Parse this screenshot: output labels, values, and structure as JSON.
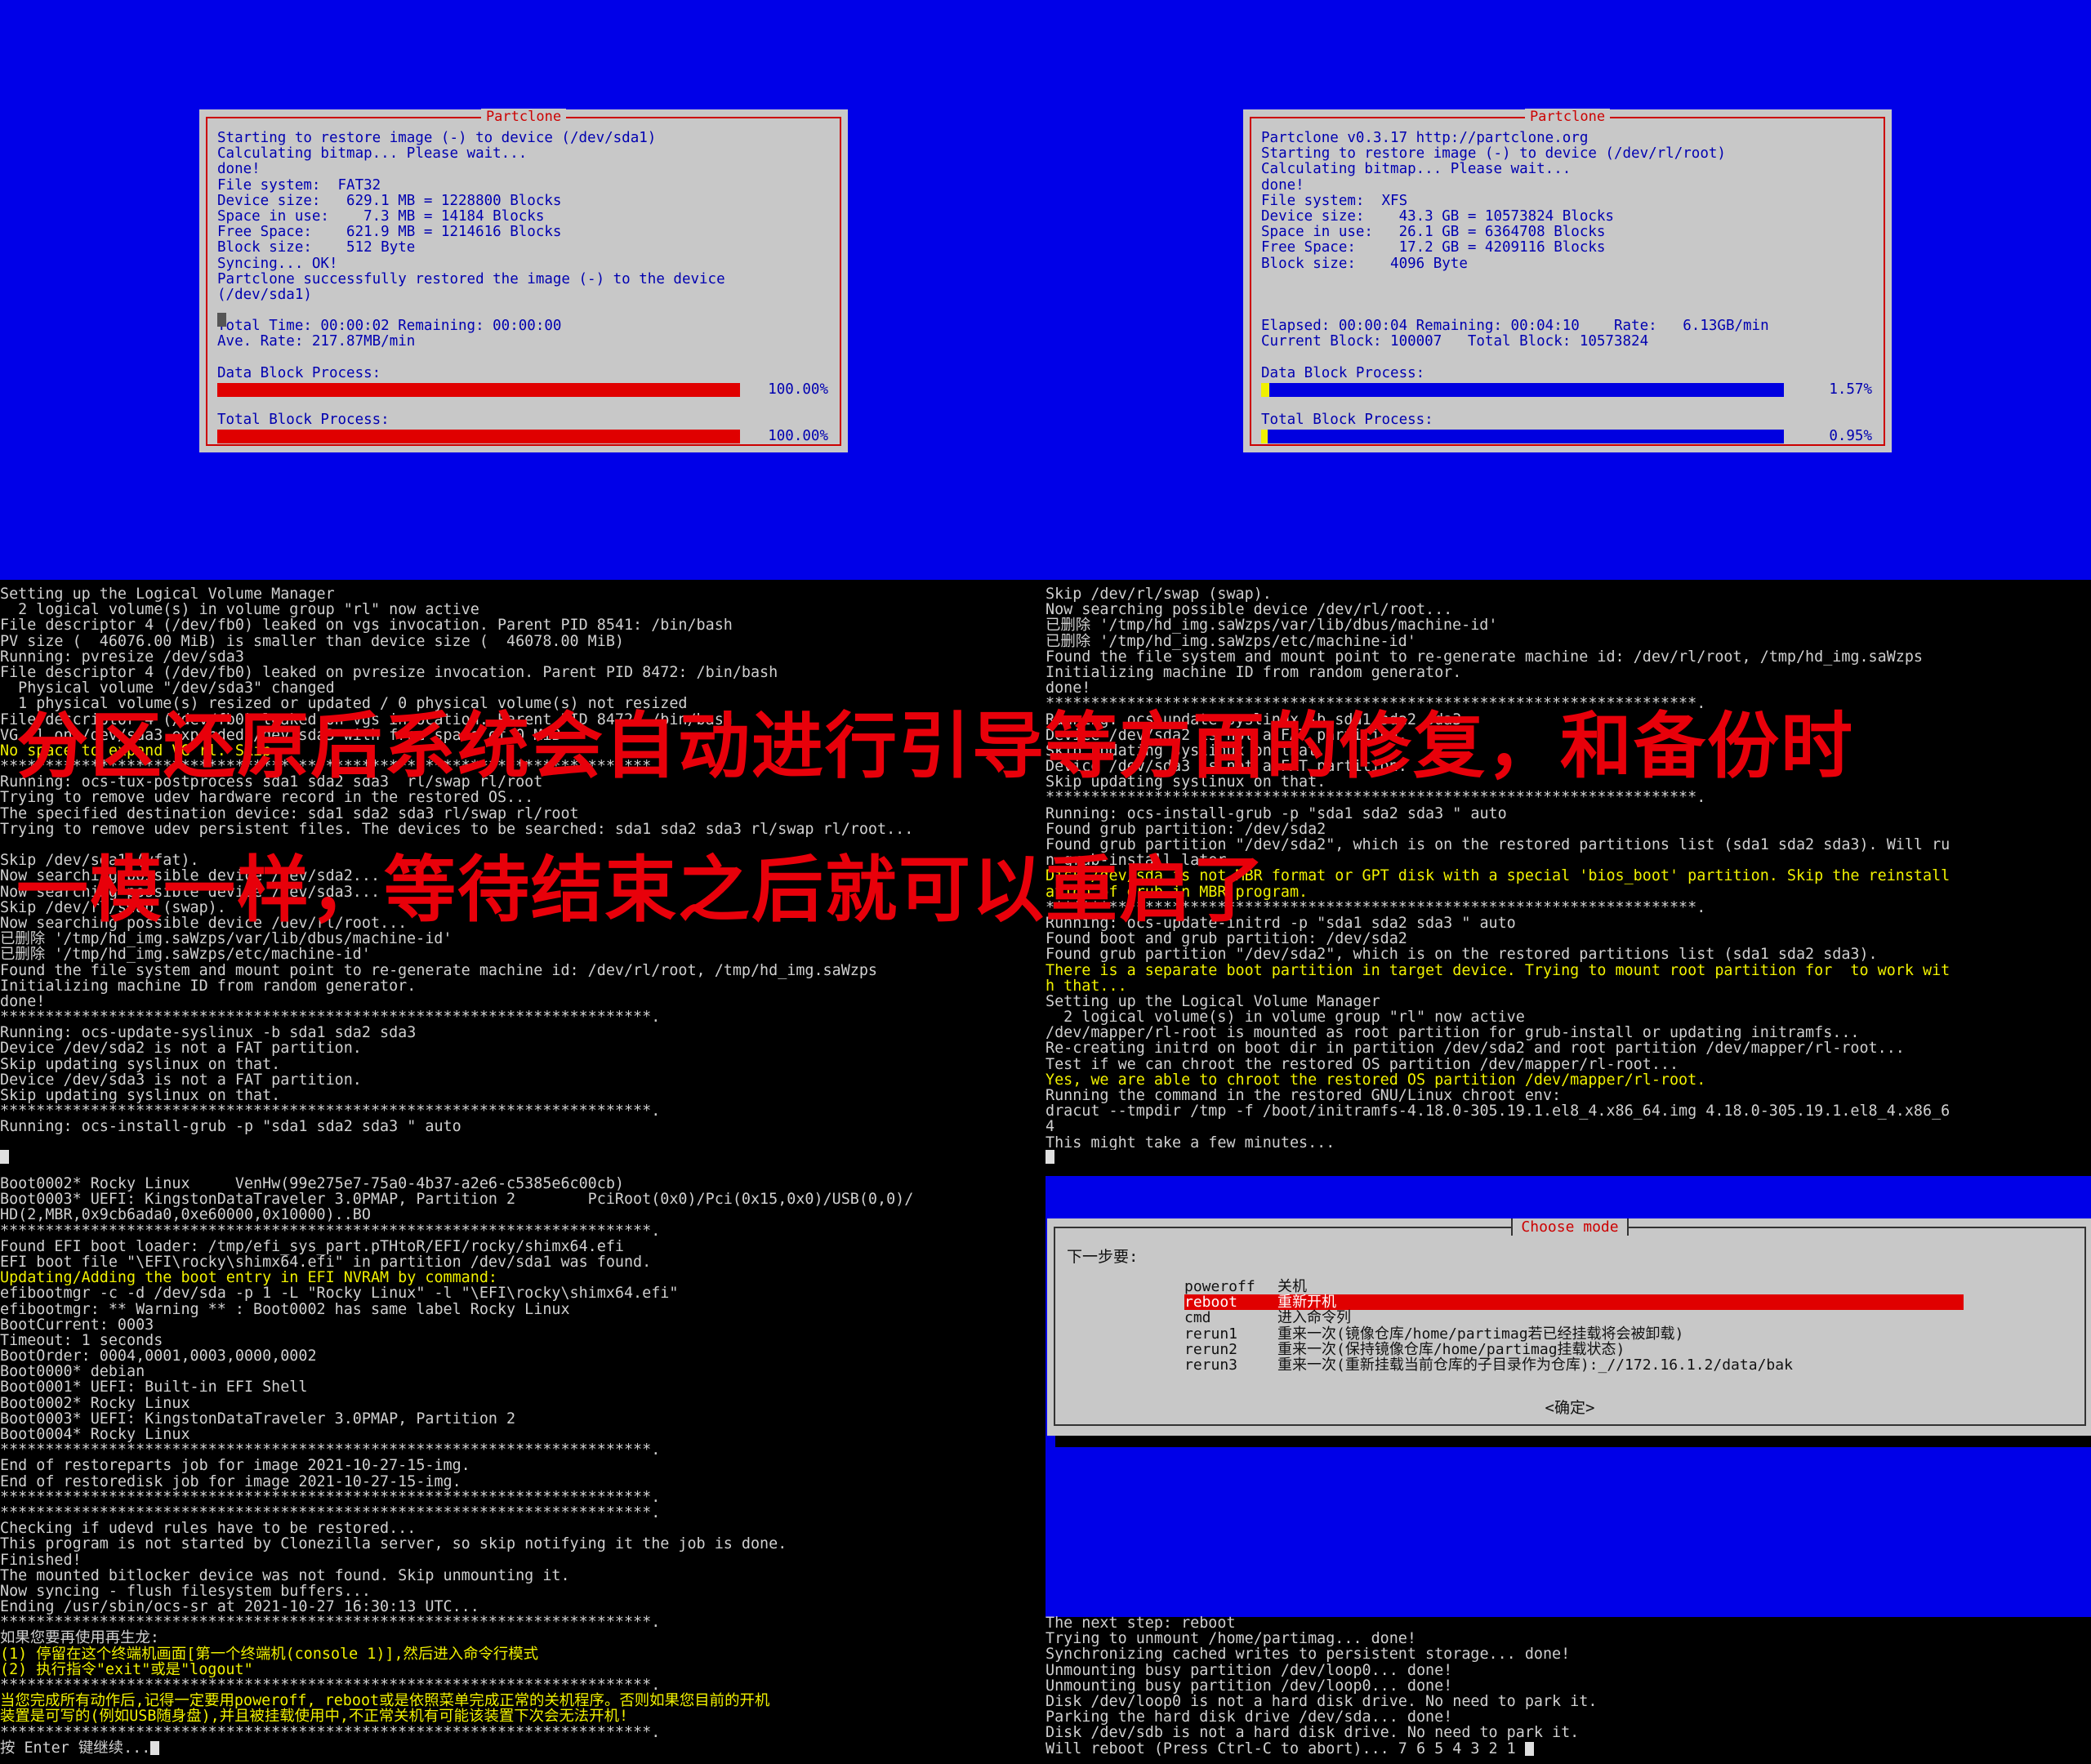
{
  "partclone_left": {
    "title": "Partclone",
    "lines": [
      "Starting to restore image (-) to device (/dev/sda1)",
      "Calculating bitmap... Please wait...",
      "done!",
      "File system:  FAT32",
      "Device size:   629.1 MB = 1228800 Blocks",
      "Space in use:    7.3 MB = 14184 Blocks",
      "Free Space:    621.9 MB = 1214616 Blocks",
      "Block size:    512 Byte",
      "Syncing... OK!",
      "Partclone successfully restored the image (-) to the device",
      "(/dev/sda1)",
      "",
      "Total Time: 00:00:02 Remaining: 00:00:00",
      "Ave. Rate: 217.87MB/min",
      "",
      "Data Block Process:",
      "",
      "",
      "Total Block Process:"
    ],
    "data_progress_label": "100.00%",
    "data_progress": 1.0,
    "total_progress_label": "100.00%",
    "total_progress": 1.0,
    "bar_color": "#e00000"
  },
  "partclone_right": {
    "title": "Partclone",
    "lines": [
      "Partclone v0.3.17 http://partclone.org",
      "Starting to restore image (-) to device (/dev/rl/root)",
      "Calculating bitmap... Please wait...",
      "done!",
      "File system:  XFS",
      "Device size:    43.3 GB = 10573824 Blocks",
      "Space in use:   26.1 GB = 6364708 Blocks",
      "Free Space:     17.2 GB = 4209116 Blocks",
      "Block size:    4096 Byte",
      "",
      "",
      "",
      "Elapsed: 00:00:04 Remaining: 00:04:10    Rate:   6.13GB/min",
      "Current Block: 100007   Total Block: 10573824",
      "",
      "Data Block Process:",
      "",
      "",
      "Total Block Process:"
    ],
    "data_progress_label": "1.57%",
    "data_progress": 0.0157,
    "total_progress_label": "0.95%",
    "total_progress": 0.0095,
    "bar_color": "#0000e0"
  },
  "terminal_left_top": [
    "Setting up the Logical Volume Manager",
    "  2 logical volume(s) in volume group \"rl\" now active",
    "File descriptor 4 (/dev/fb0) leaked on vgs invocation. Parent PID 8541: /bin/bash",
    "PV size (  46076.00 MiB) is smaller than device size (  46078.00 MiB)",
    "Running: pvresize /dev/sda3",
    "File descriptor 4 (/dev/fb0) leaked on pvresize invocation. Parent PID 8472: /bin/bash",
    "  Physical volume \"/dev/sda3\" changed",
    "  1 physical volume(s) resized or updated / 0 physical volume(s) not resized",
    "File descriptor 4 (/dev/fb0) leaked on vgs invocation. Parent PID 8472: /bin/bash",
    "VG rl on /dev/sda3 expanded /dev/sda3 with free space of 0 MiB",
    "No space to expand VG rl. Skip",
    "************************************************************************.",
    "Running: ocs-tux-postprocess sda1 sda2 sda3  rl/swap rl/root",
    "Trying to remove udev hardware record in the restored OS...",
    "The specified destination device: sda1 sda2 sda3 rl/swap rl/root",
    "Trying to remove udev persistent files. The devices to be searched: sda1 sda2 sda3 rl/swap rl/root...",
    "",
    "Skip /dev/sda1 (vfat).",
    "Now searching possible device /dev/sda2...",
    "Now searching possible device /dev/sda3...",
    "Skip /dev/rl/swap (swap).",
    "Now searching possible device /dev/rl/root...",
    "已删除 '/tmp/hd_img.saWzps/var/lib/dbus/machine-id'",
    "已删除 '/tmp/hd_img.saWzps/etc/machine-id'",
    "Found the file system and mount point to re-generate machine id: /dev/rl/root, /tmp/hd_img.saWzps",
    "Initializing machine ID from random generator.",
    "done!",
    "************************************************************************.",
    "Running: ocs-update-syslinux -b sda1 sda2 sda3",
    "Device /dev/sda2 is not a FAT partition.",
    "Skip updating syslinux on that.",
    "Device /dev/sda3 is not a FAT partition.",
    "Skip updating syslinux on that.",
    "************************************************************************.",
    "Running: ocs-install-grub -p \"sda1 sda2 sda3 \" auto"
  ],
  "terminal_left_bottom": [
    "Boot0002* Rocky Linux     VenHw(99e275e7-75a0-4b37-a2e6-c5385e6c00cb)",
    "Boot0003* UEFI: KingstonDataTraveler 3.0PMAP, Partition 2        PciRoot(0x0)/Pci(0x15,0x0)/USB(0,0)/",
    "HD(2,MBR,0x9cb6ada0,0xe60000,0x10000)..BO",
    "************************************************************************.",
    "Found EFI boot loader: /tmp/efi_sys_part.pTHtoR/EFI/rocky/shimx64.efi",
    "EFI boot file \"\\EFI\\rocky\\shimx64.efi\" in partition /dev/sda1 was found.",
    "Updating/Adding the boot entry in EFI NVRAM by command:",
    "efibootmgr -c -d /dev/sda -p 1 -L \"Rocky Linux\" -l \"\\EFI\\rocky\\shimx64.efi\"",
    "efibootmgr: ** Warning ** : Boot0002 has same label Rocky Linux",
    "BootCurrent: 0003",
    "Timeout: 1 seconds",
    "BootOrder: 0004,0001,0003,0000,0002",
    "Boot0000* debian",
    "Boot0001* UEFI: Built-in EFI Shell",
    "Boot0002* Rocky Linux",
    "Boot0003* UEFI: KingstonDataTraveler 3.0PMAP, Partition 2",
    "Boot0004* Rocky Linux",
    "************************************************************************.",
    "End of restoreparts job for image 2021-10-27-15-img.",
    "End of restoredisk job for image 2021-10-27-15-img.",
    "************************************************************************.",
    "************************************************************************.",
    "Checking if udevd rules have to be restored...",
    "This program is not started by Clonezilla server, so skip notifying it the job is done.",
    "Finished!",
    "The mounted bitlocker device was not found. Skip unmounting it.",
    "Now syncing - flush filesystem buffers...",
    "Ending /usr/sbin/ocs-sr at 2021-10-27 16:30:13 UTC...",
    "************************************************************************.",
    "如果您要再使用再生龙:",
    "(1) 停留在这个终端机画面[第一个终端机(console 1)],然后进入命令行模式",
    "(2) 执行指令\"exit\"或是\"logout\"",
    "************************************************************************.",
    "当您完成所有动作后,记得一定要用poweroff, reboot或是依照菜单完成正常的关机程序。否则如果您目前的开机",
    "装置是可写的(例如USB随身盘),并且被挂载使用中,不正常关机有可能该装置下次会无法开机!",
    "************************************************************************.",
    "按 Enter 键继续..."
  ],
  "terminal_right_top": [
    "Skip /dev/rl/swap (swap).",
    "Now searching possible device /dev/rl/root...",
    "已删除 '/tmp/hd_img.saWzps/var/lib/dbus/machine-id'",
    "已删除 '/tmp/hd_img.saWzps/etc/machine-id'",
    "Found the file system and mount point to re-generate machine id: /dev/rl/root, /tmp/hd_img.saWzps",
    "Initializing machine ID from random generator.",
    "done!",
    "************************************************************************.",
    "Running: ocs-update-syslinux -b sda1 sda2 sda3",
    "Device /dev/sda2 is not a FAT partition.",
    "Skip updating syslinux on that.",
    "Device /dev/sda3 is not a FAT partition.",
    "Skip updating syslinux on that.",
    "************************************************************************.",
    "Running: ocs-install-grub -p \"sda1 sda2 sda3 \" auto",
    "Found grub partition: /dev/sda2",
    "Found grub partition \"/dev/sda2\", which is on the restored partitions list (sda1 sda2 sda3). Will ru",
    "n grub-install later.",
    "Disk /dev/sda is not MBR format or GPT disk with a special 'bios_boot' partition. Skip the reinstall",
    "ation of grub in MBR program.",
    "************************************************************************.",
    "Running: ocs-update-initrd -p \"sda1 sda2 sda3 \" auto",
    "Found boot and grub partition: /dev/sda2",
    "Found grub partition \"/dev/sda2\", which is on the restored partitions list (sda1 sda2 sda3).",
    "There is a separate boot partition in target device. Trying to mount root partition for  to work wit",
    "h that...",
    "Setting up the Logical Volume Manager",
    "  2 logical volume(s) in volume group \"rl\" now active",
    "/dev/mapper/rl-root is mounted as root partition for grub-install or updating initramfs...",
    "Re-creating initrd on boot dir in partition /dev/sda2 and root partition /dev/mapper/rl-root...",
    "Test if we can chroot the restored OS partition /dev/mapper/rl-root...",
    "Yes, we are able to chroot the restored OS partition /dev/mapper/rl-root.",
    "Running the command in the restored GNU/Linux chroot env:",
    "dracut --tmpdir /tmp -f /boot/initramfs-4.18.0-305.19.1.el8_4.x86_64.img 4.18.0-305.19.1.el8_4.x86_6",
    "4",
    "This might take a few minutes..."
  ],
  "terminal_right_bottom": [
    "The next step: reboot",
    "Trying to unmount /home/partimag... done!",
    "Synchronizing cached writes to persistent storage... done!",
    "Unmounting busy partition /dev/loop0... done!",
    "Unmounting busy partition /dev/loop0... done!",
    "Disk /dev/loop0 is not a hard disk drive. No need to park it.",
    "Parking the hard disk drive /dev/sda... done!",
    "Disk /dev/sdb is not a hard disk drive. No need to park it.",
    "Will reboot (Press Ctrl-C to abort)... 7 6 5 4 3 2 1"
  ],
  "dialog": {
    "title": "Choose mode",
    "prompt": "下一步要:",
    "items": [
      {
        "key": "poweroff",
        "desc": "关机"
      },
      {
        "key": "reboot",
        "desc": "重新开机"
      },
      {
        "key": "cmd",
        "desc": "进入命令列"
      },
      {
        "key": "rerun1",
        "desc": "重来一次(镜像仓库/home/partimag若已经挂载将会被卸载)"
      },
      {
        "key": "rerun2",
        "desc": "重来一次(保持镜像仓库/home/partimag挂载状态)"
      },
      {
        "key": "rerun3",
        "desc": "重来一次(重新挂载当前仓库的子目录作为仓库):_//172.16.1.2/data/bak"
      }
    ],
    "selected": "reboot",
    "ok_label": "<确定>"
  },
  "overlay": {
    "line1": "分区还原后系统会自动进行引导等方面的修复，和备份时",
    "line2": "一模一样，等待结束之后就可以重启了"
  },
  "colors": {
    "blue_bg": "#0000e8",
    "terminal_text": "#d0d0d0",
    "highlight_text": "#f0f000",
    "overlay_text": "#e8000a"
  }
}
